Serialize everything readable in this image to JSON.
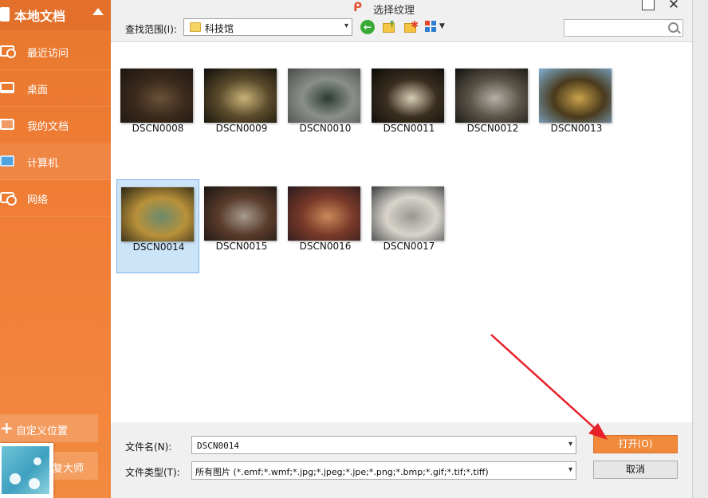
{
  "sidebar": {
    "header": "本地文档",
    "items": [
      {
        "label": "最近访问"
      },
      {
        "label": "桌面"
      },
      {
        "label": "我的文档"
      },
      {
        "label": "计算机"
      },
      {
        "label": "网络"
      }
    ],
    "custom_location_label": "自定义位置",
    "master_label": "复大师"
  },
  "dialog": {
    "title": "选择纹理",
    "look_in_label": "查找范围(I):",
    "look_in_value": "科技馆",
    "search_placeholder": "",
    "files": [
      {
        "name": "DSCN0008",
        "colors": [
          "#1c1510",
          "#3b2a1c",
          "#6b5138"
        ]
      },
      {
        "name": "DSCN0009",
        "colors": [
          "#0e0d0a",
          "#5a4a2a",
          "#c9b27a"
        ]
      },
      {
        "name": "DSCN0010",
        "colors": [
          "#4a4c48",
          "#8b8f8a",
          "#2c3b33"
        ]
      },
      {
        "name": "DSCN0011",
        "colors": [
          "#0b0a08",
          "#3a2f1f",
          "#d6cdb5"
        ]
      },
      {
        "name": "DSCN0012",
        "colors": [
          "#121110",
          "#5b5448",
          "#b5b1a8"
        ]
      },
      {
        "name": "DSCN0013",
        "colors": [
          "#7eb0d6",
          "#4a3a1c",
          "#c9a24a"
        ]
      },
      {
        "name": "DSCN0014",
        "colors": [
          "#2a2414",
          "#b8913a",
          "#6b8a6e"
        ],
        "selected": true
      },
      {
        "name": "DSCN0015",
        "colors": [
          "#1a1512",
          "#5a3b2a",
          "#a59b8e"
        ]
      },
      {
        "name": "DSCN0016",
        "colors": [
          "#2a1a1e",
          "#7a3a2a",
          "#c98a5a"
        ]
      },
      {
        "name": "DSCN0017",
        "colors": [
          "#3a3c3e",
          "#d8d4cc",
          "#9a9892"
        ]
      }
    ],
    "file_name_label": "文件名(N):",
    "file_name_value": "DSCN0014",
    "file_type_label": "文件类型(T):",
    "file_type_value": "所有图片 (*.emf;*.wmf;*.jpg;*.jpeg;*.jpe;*.png;*.bmp;*.gif;*.tif;*.tiff)",
    "open_label": "打开(O)",
    "cancel_label": "取消"
  },
  "colors": {
    "sidebar": "#f07d35",
    "accent": "#f08a3a",
    "selection": "#cce4f7"
  }
}
